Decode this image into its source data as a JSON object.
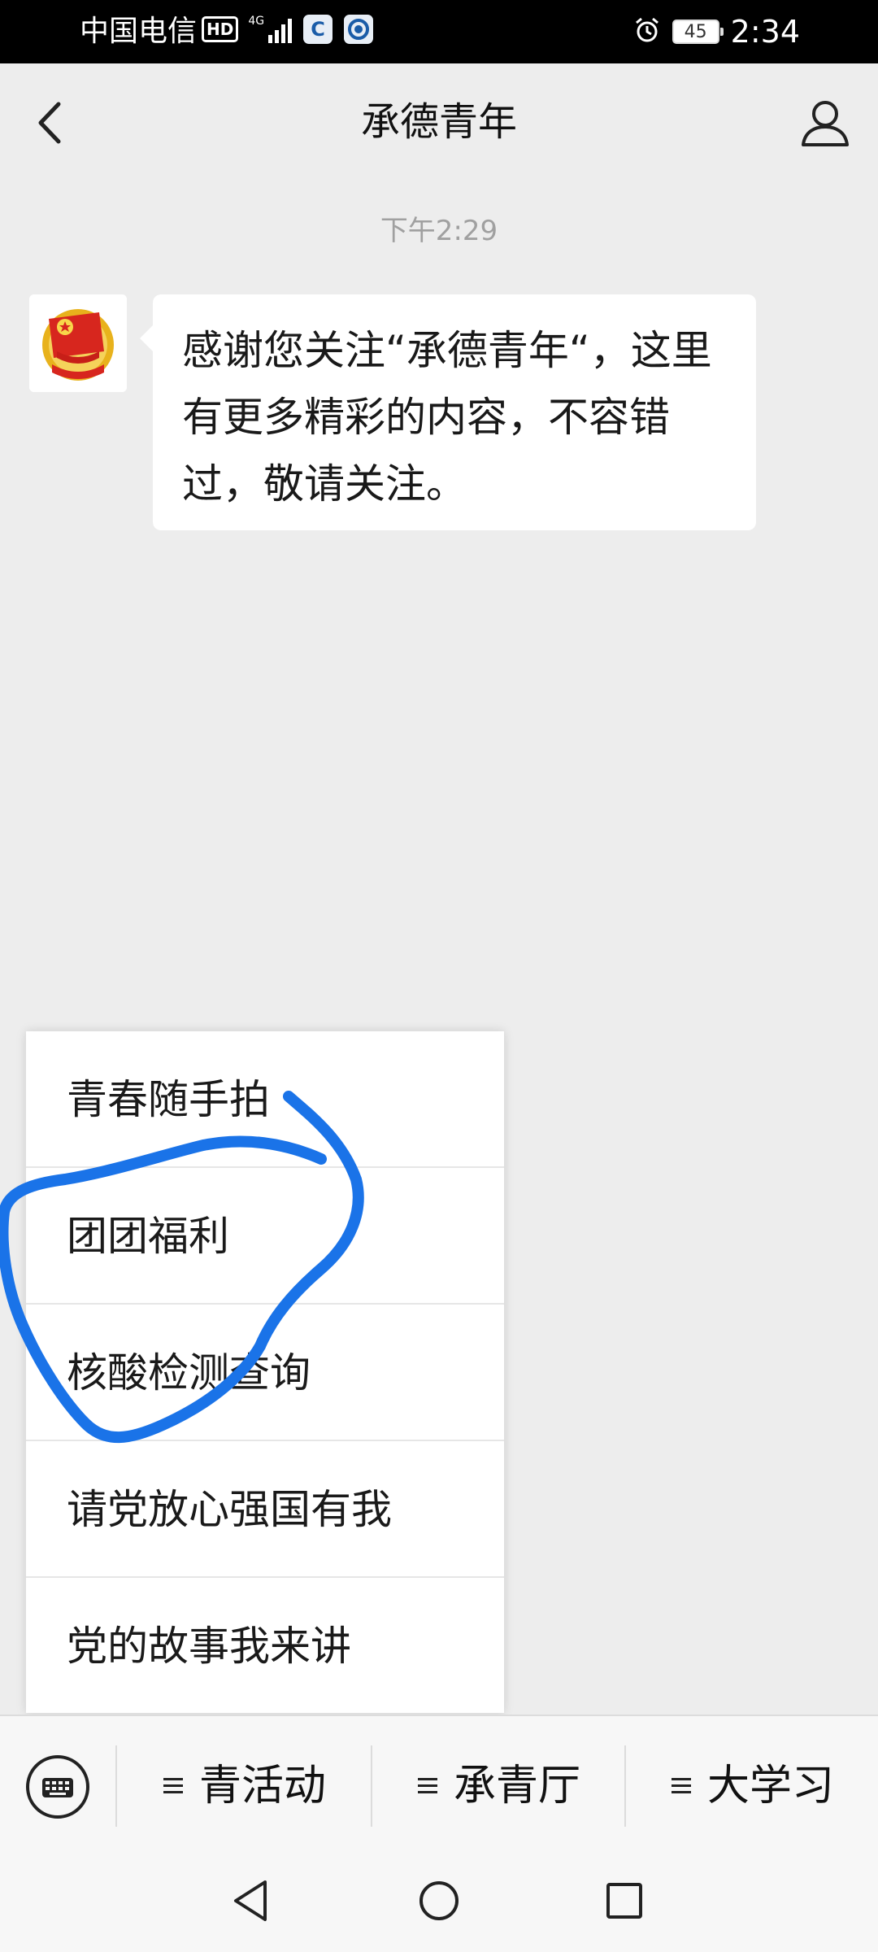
{
  "status_bar": {
    "carrier": "中国电信",
    "hd_badge": "HD",
    "network_type": "4G",
    "app_icon_1": "C",
    "battery": "45",
    "time": "2:34"
  },
  "nav": {
    "title": "承德青年"
  },
  "chat": {
    "timestamp": "下午2:29",
    "message": "感谢您关注“承德青年“，这里有更多精彩的内容，不容错过，敬请关注。"
  },
  "popup_menu": {
    "items": [
      {
        "label": "青春随手拍"
      },
      {
        "label": "团团福利"
      },
      {
        "label": "核酸检测查询"
      },
      {
        "label": "请党放心强国有我"
      },
      {
        "label": "党的故事我来讲"
      }
    ]
  },
  "bottom_menu": {
    "tabs": [
      {
        "label": "青活动"
      },
      {
        "label": "承青厅"
      },
      {
        "label": "大学习"
      }
    ]
  },
  "colors": {
    "annotation_stroke": "#1a73e8",
    "background": "#ededed",
    "bubble": "#ffffff"
  }
}
